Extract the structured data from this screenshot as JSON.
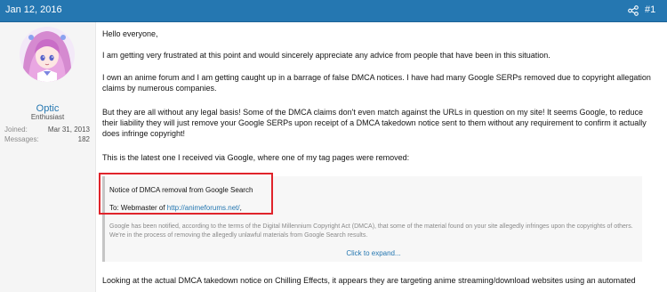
{
  "post": {
    "date": "Jan 12, 2016",
    "number": "#1",
    "share_icon": "share-icon"
  },
  "user": {
    "name": "Optic",
    "title": "Enthusiast",
    "joined_label": "Joined:",
    "joined_value": "Mar 31, 2013",
    "messages_label": "Messages:",
    "messages_value": "182"
  },
  "content": {
    "p1": "Hello everyone,",
    "p2": "I am getting very frustrated at this point and would sincerely appreciate any advice from people that have been in this situation.",
    "p3": "I own an anime forum and I am getting caught up in a barrage of false DMCA notices. I have had many Google SERPs removed due to copyright allegation claims by numerous companies.",
    "p4": "But they are all without any legal basis! Some of the DMCA claims don't even match against the URLs in question on my site! It seems Google, to reduce their liability they will just remove your Google SERPs upon receipt of a DMCA takedown notice sent to them without any requirement to confirm it actually does infringe copyright!",
    "p5": "This is the latest one I received via Google, where one of my tag pages were removed:",
    "p6": "Looking at the actual DMCA takedown notice on Chilling Effects, it appears they are targeting anime streaming/download websites using an automated"
  },
  "quote": {
    "line1": "Notice of DMCA removal from Google Search",
    "line2_prefix": "To: Webmaster of ",
    "line2_link": "http://animeforums.net/",
    "line2_suffix": ",",
    "faded": "Google has been notified, according to the terms of the Digital Millennium Copyright Act (DMCA), that some of the material found on your site allegedly infringes upon the copyrights of others. We're in the process of removing the allegedly unlawful materials from Google Search results.",
    "expand": "Click to expand..."
  },
  "colors": {
    "header": "#2577b1",
    "highlight": "#e0242b"
  }
}
